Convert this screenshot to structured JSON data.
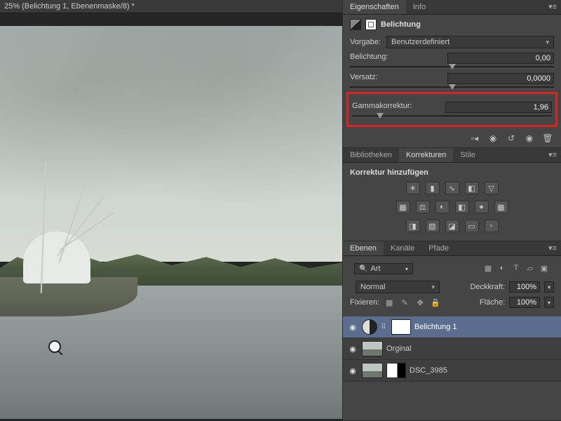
{
  "document": {
    "title": "25% (Belichtung 1, Ebenenmaske/8) *"
  },
  "properties": {
    "tabs": {
      "eigenschaften": "Eigenschaften",
      "info": "Info"
    },
    "adjustment_name": "Belichtung",
    "preset_label": "Vorgabe:",
    "preset_value": "Benutzerdefiniert",
    "exposure": {
      "label": "Belichtung:",
      "value": "0,00",
      "pos": 50
    },
    "offset": {
      "label": "Versatz:",
      "value": "0,0000",
      "pos": 50
    },
    "gamma": {
      "label": "Gammakorrektur:",
      "value": "1,96",
      "pos": 14
    }
  },
  "corrections": {
    "tabs": {
      "bibliotheken": "Bibliotheken",
      "korrekturen": "Korrekturen",
      "stile": "Stile"
    },
    "title": "Korrektur hinzufügen"
  },
  "layers": {
    "tabs": {
      "ebenen": "Ebenen",
      "kanaele": "Kanäle",
      "pfade": "Pfade"
    },
    "filter_kind": "Art",
    "blend_mode": "Normal",
    "opacity_label": "Deckkraft:",
    "opacity_value": "100%",
    "lock_label": "Fixieren:",
    "fill_label": "Fläche:",
    "fill_value": "100%",
    "items": [
      {
        "name": "Belichtung 1",
        "type": "adjustment"
      },
      {
        "name": "Orginal",
        "type": "image"
      },
      {
        "name": "DSC_3985",
        "type": "image"
      }
    ]
  }
}
